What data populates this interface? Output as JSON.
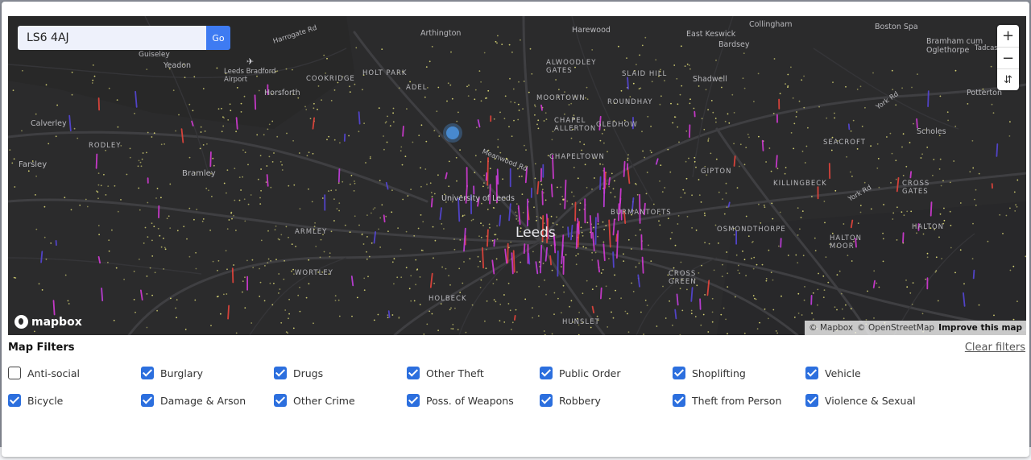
{
  "search": {
    "value": "LS6 4AJ",
    "go_label": "Go"
  },
  "map_controls": {
    "zoom_in": "+",
    "zoom_out": "−",
    "compass": "⇵"
  },
  "attribution": {
    "mapbox": "© Mapbox",
    "osm": "© OpenStreetMap",
    "improve": "Improve this map"
  },
  "logo_text": "mapbox",
  "place_labels": {
    "leeds": "Leeds",
    "university": "University of Leeds",
    "meanwood_rd": "Meanwood Rd",
    "york_rd_1": "York Rd",
    "york_rd_2": "York Rd",
    "harrogate_rd": "Harrogate Rd",
    "arthington": "Arthington",
    "harewood": "Harewood",
    "east_keswick": "East Keswick",
    "collingham": "Collingham",
    "boston_spa": "Boston Spa",
    "bardsey": "Bardsey",
    "bramham": "Bramham cum\nOglethorpe",
    "tadcaster": "Tadcaster",
    "yeadon": "Yeadon",
    "guiseley": "Guiseley",
    "airport": "Leeds Bradford\nAirport",
    "cookridge": "COOKRIDGE",
    "holt_park": "HOLT PARK",
    "adel": "ADEL",
    "alwoodley_gates": "ALWOODLEY\nGATES",
    "slaid_hill": "SLAID HILL",
    "shadwell": "Shadwell",
    "moortown": "MOORTOWN",
    "roundhay": "ROUNDHAY",
    "horsforth": "Horsforth",
    "calverley": "Calverley",
    "rodley": "RODLEY",
    "chapel_allerton": "CHAPEL\nALLERTON",
    "gledhow": "GLEDHOW",
    "potterton": "Potterton",
    "scholes": "Scholes",
    "seacroft": "SEACROFT",
    "chapeltown": "CHAPELTOWN",
    "gipton": "GIPTON",
    "killingbeck": "KILLINGBECK",
    "cross_gates": "CROSS\nGATES",
    "farsley": "Farsley",
    "bramley": "Bramley",
    "burmantofts": "BURMANTOFTS",
    "osmondthorpe": "OSMONDTHORPE",
    "halton_moor": "HALTON\nMOOR",
    "halton": "HALTON",
    "armley": "ARMLEY",
    "wortley": "WORTLEY",
    "cross_green": "CROSS\nGREEN",
    "holbeck": "HOLBECK",
    "hunslet": "HUNSLET"
  },
  "filters": {
    "title": "Map Filters",
    "clear": "Clear filters",
    "items": [
      {
        "label": "Anti-social",
        "checked": false
      },
      {
        "label": "Burglary",
        "checked": true
      },
      {
        "label": "Drugs",
        "checked": true
      },
      {
        "label": "Other Theft",
        "checked": true
      },
      {
        "label": "Public Order",
        "checked": true
      },
      {
        "label": "Shoplifting",
        "checked": true
      },
      {
        "label": "Vehicle",
        "checked": true
      },
      {
        "label": "Bicycle",
        "checked": true
      },
      {
        "label": "Damage & Arson",
        "checked": true
      },
      {
        "label": "Other Crime",
        "checked": true
      },
      {
        "label": "Poss. of Weapons",
        "checked": true
      },
      {
        "label": "Robbery",
        "checked": true
      },
      {
        "label": "Theft from Person",
        "checked": true
      },
      {
        "label": "Violence & Sexual",
        "checked": true
      }
    ]
  },
  "colors": {
    "map_bg": "#2b2b2c",
    "accent": "#2c6fde",
    "crime_dot": "#e6e27a",
    "crime_bar_magenta": "#d43ad6",
    "crime_bar_red": "#e8453c",
    "crime_bar_blue": "#5646d8"
  }
}
